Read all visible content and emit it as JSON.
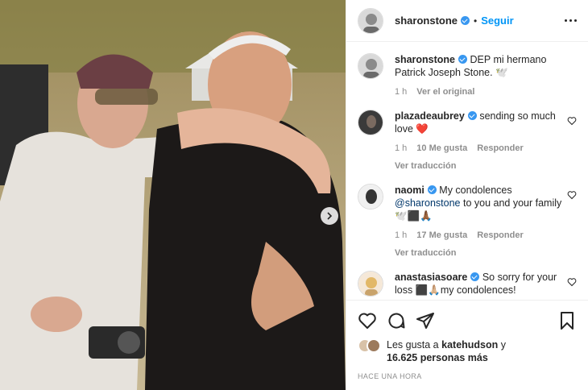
{
  "post": {
    "username": "sharonstone",
    "dot": "•",
    "follow_label": "Seguir",
    "caption": {
      "username": "sharonstone",
      "text": "DEP mi hermano Patrick Joseph Stone. 🕊️",
      "time": "1 h",
      "see_original": "Ver el original"
    },
    "comments": [
      {
        "username": "plazadeaubrey",
        "text": "sending so much love ❤️",
        "time": "1 h",
        "likes": "10 Me gusta",
        "reply": "Responder",
        "translate": "Ver traducción"
      },
      {
        "username": "naomi",
        "text_before": "My condolences",
        "mention": "@sharonstone",
        "text_after": "to you and your family 🕊️⬛🙏🏾",
        "time": "1 h",
        "likes": "17 Me gusta",
        "reply": "Responder",
        "translate": "Ver traducción"
      },
      {
        "username": "anastasiasoare",
        "text": "So sorry for your loss ⬛🙏🏼my condolences!"
      }
    ],
    "likes_prefix": "Les gusta a",
    "likes_user": "katehudson",
    "likes_and": "y",
    "likes_count": "16.625 personas más",
    "posted_ago": "HACE UNA HORA"
  },
  "icons": {
    "like": "heart-icon",
    "comment": "comment-bubble-icon",
    "share": "paper-plane-icon",
    "save": "bookmark-icon",
    "more": "ellipsis-icon",
    "next": "chevron-right-icon"
  },
  "colors": {
    "accent": "#0095f6",
    "verified": "#3897f0",
    "muted": "#8e8e8e"
  }
}
